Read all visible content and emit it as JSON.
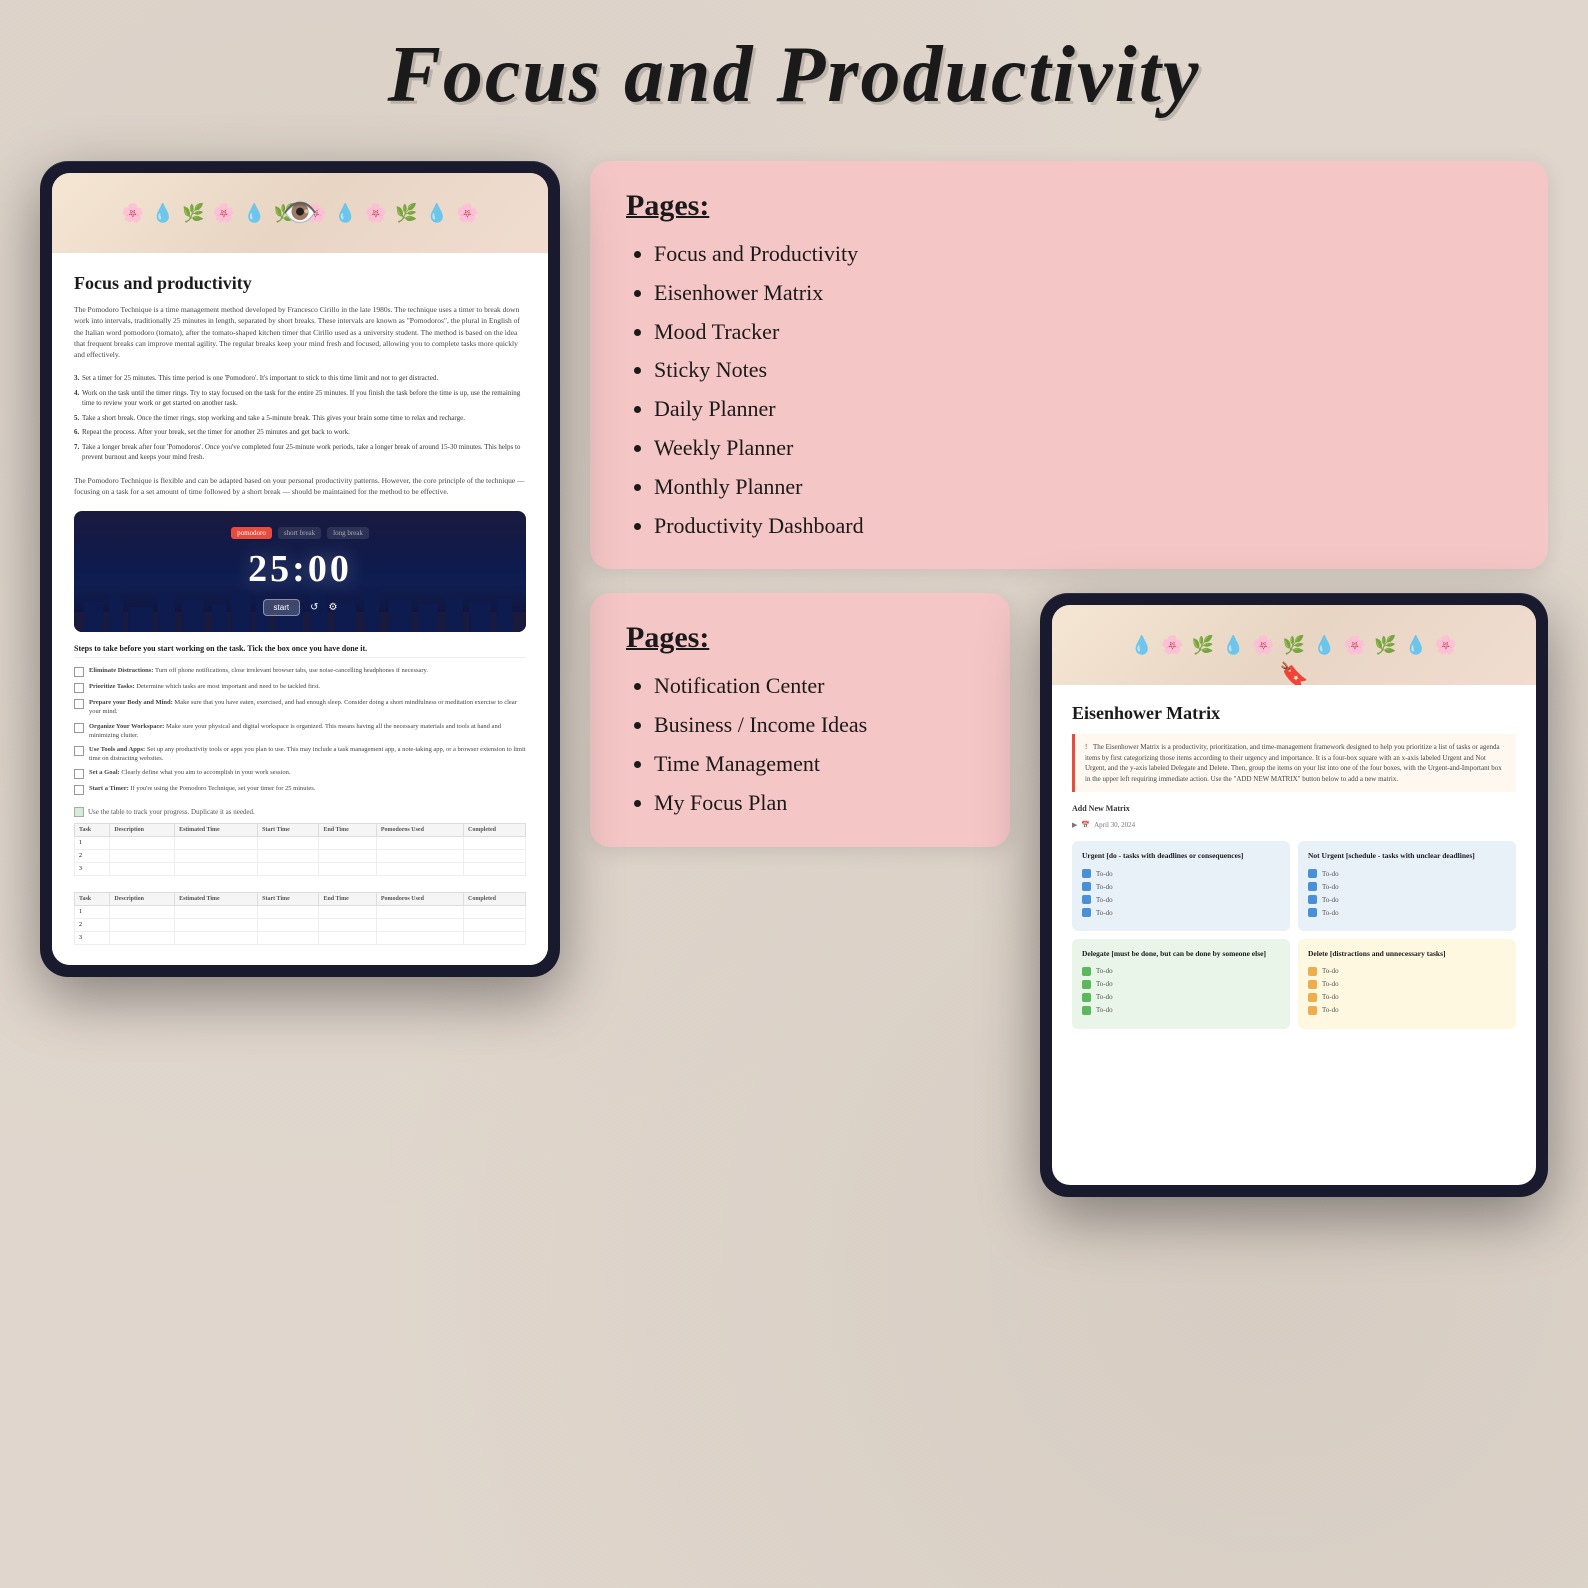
{
  "page": {
    "title": "Focus and Productivity",
    "background_color": "#e8e0d8"
  },
  "top_right_card": {
    "title": "Pages:",
    "items": [
      "Focus and Productivity",
      "Eisenhower Matrix",
      "Mood Tracker",
      "Sticky Notes",
      "Daily Planner",
      "Weekly Planner",
      "Monthly Planner",
      "Productivity Dashboard"
    ]
  },
  "bottom_left_card": {
    "title": "Pages:",
    "items": [
      "Notification Center",
      "Business / Income Ideas",
      "Time Management",
      "My Focus Plan"
    ]
  },
  "tablet1": {
    "page_title": "Focus and productivity",
    "body_text": "The Pomodoro Technique is a time management method developed by Francesco Cirillo in the late 1980s. The technique uses a timer to break down work into intervals, traditionally 25 minutes in length, separated by short breaks. These intervals are known as \"Pomodoros\", the plural in English of the Italian word pomodoro (tomato), after the tomato-shaped kitchen timer that Cirillo used as a university student. The method is based on the idea that frequent breaks can improve mental agility. The regular breaks keep your mind fresh and focused, allowing you to complete tasks more quickly and effectively.",
    "steps": [
      {
        "num": "3",
        "text": "Set a timer for 25 minutes. This time period is one 'Pomodoro'. It's important to stick to this time limit and not to get distracted."
      },
      {
        "num": "4",
        "text": "Work on the task until the timer rings. Try to stay focused on the task for the entire 25 minutes. If you finish the task before the time is up, use the remaining time to review your work or get started on another task."
      },
      {
        "num": "5",
        "text": "Take a short break. Once the timer rings, stop working and take a 5-minute break. This gives your brain some time to relax and recharge."
      },
      {
        "num": "6",
        "text": "Repeat the process. After your break, set the timer for another 25 minutes and get back to work."
      },
      {
        "num": "7",
        "text": "Take a longer break after four 'Pomodoros'. Once you've completed four 25-minute work periods, take a longer break of around 15-30 minutes. This helps to prevent burnout and keeps your mind fresh."
      }
    ],
    "technique_note": "The Pomodoro Technique is flexible and can be adapted based on your personal productivity patterns. However, the core principle of the technique — focusing on a task for a set amount of time followed by a short break — should be maintained for the method to be effective.",
    "timer": {
      "tabs": [
        "pomodoro",
        "short break",
        "long break"
      ],
      "active_tab": "pomodoro",
      "display": "25:00",
      "start_label": "start"
    },
    "steps_section_header": "Steps to take before you start working on the task. Tick the box once you have done it.",
    "checklist": [
      {
        "text": "Eliminate Distractions: Turn off phone notifications, close irrelevant browser tabs, use noise-cancelling headphones if necessary."
      },
      {
        "text": "Prioritize Tasks: Determine which tasks are most important and need to be tackled first."
      },
      {
        "text": "Prepare your Body and Mind: Make sure that you have eaten, exercised, and had enough sleep. Consider doing a short mindfulness or meditation exercise to clear your mind."
      },
      {
        "text": "Organize Your Workspace: Make sure your physical and digital workspace is organized. This means having all the necessary materials and tools at hand and minimizing clutter."
      },
      {
        "text": "Use Tools and Apps: Set up any productivity tools or apps you plan to use. This may include a task management app, a note-taking app, or a browser extension to limit time on distracting websites."
      },
      {
        "text": "Set a Goal: Clearly define what you aim to accomplish in your work session."
      },
      {
        "text": "Start a Timer: If you're using the Pomodoro Technique, set your timer for 25 minutes."
      }
    ],
    "table_note": "Use the table to track your progress. Duplicate it as needed.",
    "table_headers": [
      "Task",
      "Description",
      "Estimated Time",
      "Start Time",
      "End Time",
      "Pomodoros Used",
      "Completed"
    ]
  },
  "tablet2": {
    "title": "Eisenhower Matrix",
    "description": "The Eisenhower Matrix is a productivity, prioritization, and time-management framework designed to help you prioritize a list of tasks or agenda items by first categorizing those items according to their urgency and importance. It is a four-box square with an x-axis labeled Urgent and Not Urgent, and the y-axis labeled Delegate and Delete. Then, group the items on your list into one of the four boxes, with the Urgent-and-Important box in the upper left requiring immediate action. Use the \"ADD NEW MATRIX\" button below to add a new matrix.",
    "add_button": "Add New Matrix",
    "date": "April 30, 2024",
    "quadrants": {
      "urgent": {
        "title": "Urgent [do - tasks with deadlines or consequences]",
        "color": "blue",
        "todos": [
          "To-do",
          "To-do",
          "To-do",
          "To-do"
        ]
      },
      "not_urgent": {
        "title": "Not Urgent [schedule - tasks with unclear deadlines]",
        "color": "blue",
        "todos": [
          "To-do",
          "To-do",
          "To-do",
          "To-do"
        ]
      },
      "delegate": {
        "title": "Delegate [must be done, but can be done by someone else]",
        "color": "green",
        "todos": [
          "To-do",
          "To-do",
          "To-do",
          "To-do"
        ]
      },
      "delete": {
        "title": "Delete [distractions and unnecessary tasks]",
        "color": "orange",
        "todos": [
          "To-do",
          "To-do",
          "To-do",
          "To-do"
        ]
      }
    }
  }
}
